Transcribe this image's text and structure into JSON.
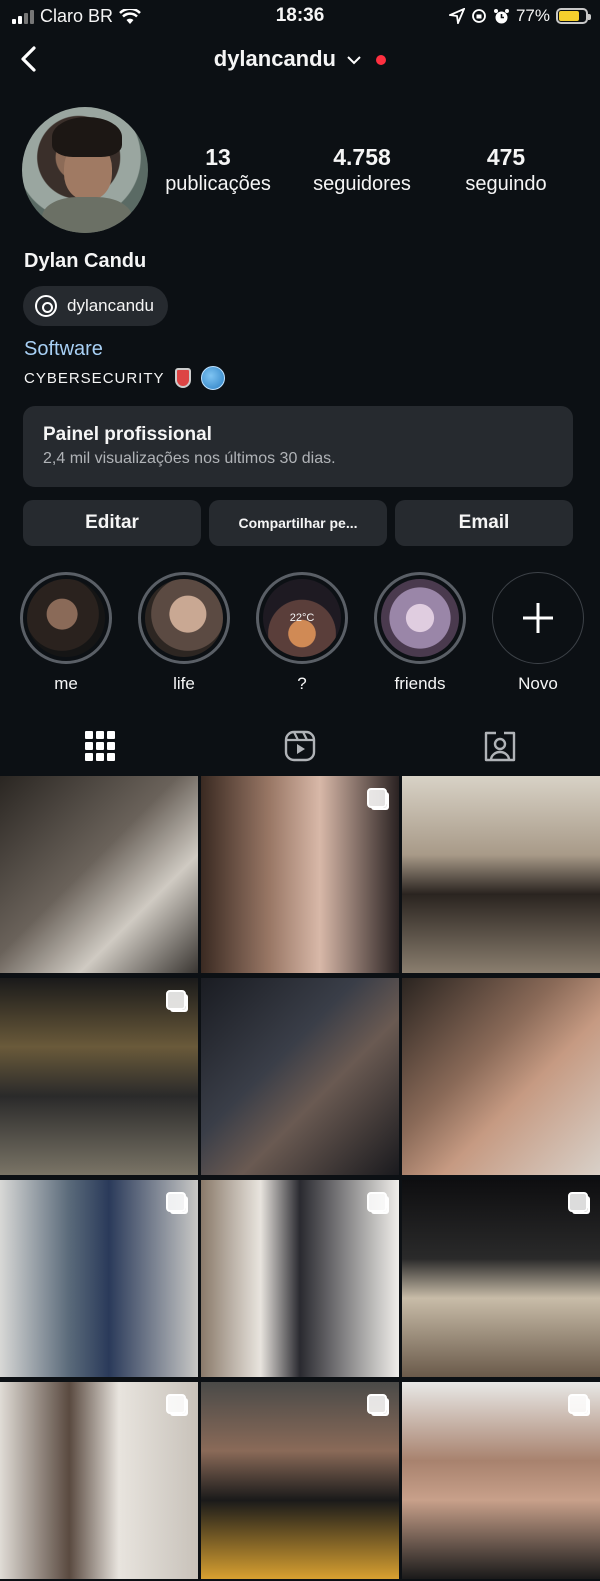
{
  "status_bar": {
    "carrier": "Claro BR",
    "time": "18:36",
    "battery": "77%",
    "battery_level": 0.77
  },
  "nav": {
    "username": "dylancandu"
  },
  "profile": {
    "stats": [
      {
        "value": "13",
        "label": "publicações"
      },
      {
        "value": "4.758",
        "label": "seguidores"
      },
      {
        "value": "475",
        "label": "seguindo"
      }
    ],
    "name": "Dylan Candu",
    "threads_handle": "dylancandu",
    "category": "Software",
    "bio": "CYBERSECURITY"
  },
  "panel": {
    "title": "Painel profissional",
    "subtitle": "2,4 mil visualizações nos últimos 30 dias."
  },
  "buttons": {
    "edit": "Editar",
    "share": "Compartilhar pe...",
    "email": "Email"
  },
  "highlights": [
    {
      "label": "me"
    },
    {
      "label": "life"
    },
    {
      "label": "?",
      "overlay": "22°C"
    },
    {
      "label": "friends"
    },
    {
      "label": "Novo"
    }
  ],
  "tabs": [
    "grid-icon",
    "reels-icon",
    "tagged-icon"
  ],
  "colors": {
    "background": "#0c1014",
    "surface": "#262a2f",
    "link": "#a8d0f5",
    "notification": "#ff3040"
  }
}
